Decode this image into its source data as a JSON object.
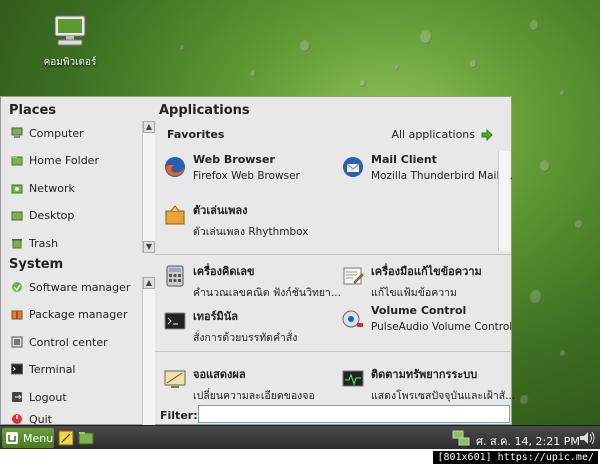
{
  "desktop": {
    "icon_label": "คอมพิวเตอร์"
  },
  "places": {
    "title": "Places",
    "items": [
      {
        "label": "Computer",
        "icon": "computer-icon"
      },
      {
        "label": "Home Folder",
        "icon": "home-folder-icon"
      },
      {
        "label": "Network",
        "icon": "network-icon"
      },
      {
        "label": "Desktop",
        "icon": "desktop-icon"
      },
      {
        "label": "Trash",
        "icon": "trash-icon"
      }
    ]
  },
  "system": {
    "title": "System",
    "items": [
      {
        "label": "Software manager",
        "icon": "software-manager-icon"
      },
      {
        "label": "Package manager",
        "icon": "package-manager-icon"
      },
      {
        "label": "Control center",
        "icon": "control-center-icon"
      },
      {
        "label": "Terminal",
        "icon": "terminal-icon"
      },
      {
        "label": "Logout",
        "icon": "logout-icon"
      },
      {
        "label": "Quit",
        "icon": "quit-icon"
      }
    ]
  },
  "applications": {
    "title": "Applications",
    "favorites_title": "Favorites",
    "all_applications_label": "All applications",
    "favorites": [
      {
        "name": "Web Browser",
        "desc": "Firefox Web Browser",
        "icon": "firefox-icon"
      },
      {
        "name": "Mail Client",
        "desc": "Mozilla Thunderbird Mail/...",
        "icon": "thunderbird-icon"
      },
      {
        "name": "ตัวเล่นเพลง",
        "desc": "ตัวเล่นเพลง Rhythmbox",
        "icon": "music-player-icon"
      }
    ],
    "more": [
      {
        "name": "เครื่องคิดเลข",
        "desc": "คำนวณเลขคณิต ฟังก์ชันวิทยา...",
        "icon": "calculator-icon"
      },
      {
        "name": "เครื่องมือแก้ไขข้อความ",
        "desc": "แก้ไขแฟ้มข้อความ",
        "icon": "text-editor-icon"
      },
      {
        "name": "เทอร์มินัล",
        "desc": "สั่งการด้วยบรรทัดคำสั่ง",
        "icon": "terminal-app-icon"
      },
      {
        "name": "Volume Control",
        "desc": "PulseAudio Volume Control",
        "icon": "volume-control-icon"
      },
      {
        "name": "จอแสดงผล",
        "desc": "เปลี่ยนความละเอียดของจอ",
        "icon": "display-icon"
      },
      {
        "name": "ติดตามทรัพยากรระบบ",
        "desc": "แสดงโพรเซสปัจจุบันและเฝ้าสั...",
        "icon": "system-monitor-icon"
      }
    ]
  },
  "filter": {
    "label": "Filter:",
    "value": ""
  },
  "taskbar": {
    "menu_label": "Menu",
    "clock": "ศ. ส.ค. 14,  2:21 PM"
  },
  "watermark": "[801x601] https://upic.me/",
  "colors": {
    "accent_green": "#6a9e3a",
    "arrow_green": "#4caf1e"
  }
}
